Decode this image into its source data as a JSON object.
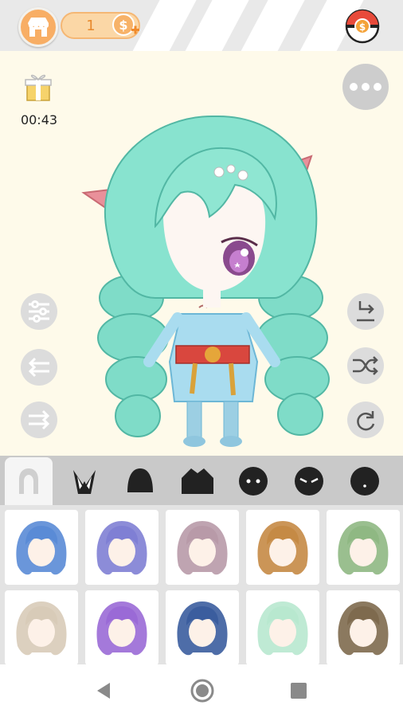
{
  "header": {
    "coins": "1",
    "shop_icon": "shop-icon",
    "coin_icon": "coin-plus-icon",
    "currency_icon": "coin-ball-icon"
  },
  "stage": {
    "timer": "00:43",
    "gift_icon": "gift-icon",
    "menu_icon": "more-dots-icon",
    "left_tools": [
      "sliders-icon",
      "swap-left-icon",
      "swap-right-icon"
    ],
    "right_tools": [
      "layer-down-icon",
      "shuffle-icon",
      "redo-icon"
    ]
  },
  "categories": [
    "hair",
    "ears",
    "head",
    "body",
    "eyes",
    "eyes-angry",
    "mouth"
  ],
  "active_category": "hair",
  "hair_grid": {
    "rows": 2,
    "columns": 5,
    "colors": [
      "#5a8bd6",
      "#7f7fd4",
      "#b89aa8",
      "#c58a45",
      "#8fb883",
      "#d8cbb8",
      "#9a6ad6",
      "#3b5d9e",
      "#b8e8cf",
      "#7e6a4e"
    ]
  },
  "nav": [
    "back-icon",
    "home-icon",
    "recents-icon"
  ]
}
